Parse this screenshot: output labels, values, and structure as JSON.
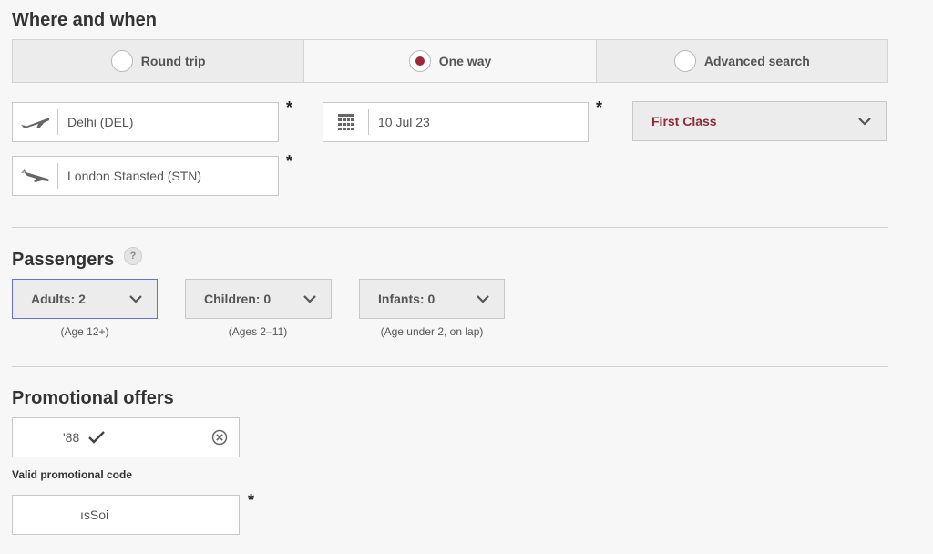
{
  "where_when": {
    "heading": "Where and when",
    "trip_types": [
      {
        "label": "Round trip",
        "selected": false
      },
      {
        "label": "One way",
        "selected": true
      },
      {
        "label": "Advanced search",
        "selected": false
      }
    ],
    "origin": "Delhi (DEL)",
    "destination": "London Stansted (STN)",
    "date": "10 Jul 23",
    "cabin_class": "First Class",
    "required_marker": "*"
  },
  "passengers": {
    "heading": "Passengers",
    "help": "?",
    "adults": {
      "label": "Adults: 2",
      "note": "(Age 12+)"
    },
    "children": {
      "label": "Children: 0",
      "note": "(Ages 2–11)"
    },
    "infants": {
      "label": "Infants: 0",
      "note": "(Age under 2, on lap)"
    }
  },
  "promo": {
    "heading": "Promotional offers",
    "code_value": "'88",
    "valid_text": "Valid promotional code",
    "second_value": "ısSoi"
  },
  "colors": {
    "accent": "#9b2a35",
    "focus": "#6a6fd8"
  },
  "icons": {
    "origin": "plane-takeoff-icon",
    "destination": "plane-landing-icon",
    "date": "calendar-icon",
    "clear": "clear-circle-icon",
    "valid": "checkmark-icon",
    "dropdown": "chevron-down-icon"
  }
}
